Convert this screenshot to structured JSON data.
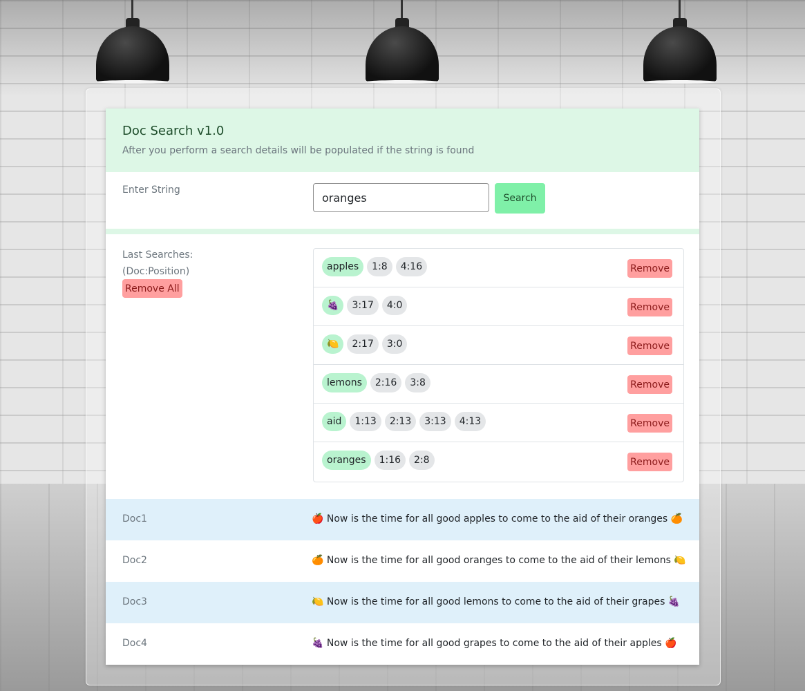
{
  "header": {
    "title": "Doc Search v1.0",
    "subtitle": "After you perform a search details will be populated if the string is found"
  },
  "search": {
    "label": "Enter String",
    "value": "oranges",
    "button_label": "Search"
  },
  "history": {
    "label_line1": "Last Searches:",
    "label_line2": "(Doc:Position)",
    "remove_all_label": "Remove All",
    "remove_label": "Remove",
    "items": [
      {
        "term": "apples",
        "positions": [
          "1:8",
          "4:16"
        ]
      },
      {
        "term": "🍇",
        "positions": [
          "3:17",
          "4:0"
        ]
      },
      {
        "term": "🍋",
        "positions": [
          "2:17",
          "3:0"
        ]
      },
      {
        "term": "lemons",
        "positions": [
          "2:16",
          "3:8"
        ]
      },
      {
        "term": "aid",
        "positions": [
          "1:13",
          "2:13",
          "3:13",
          "4:13"
        ]
      },
      {
        "term": "oranges",
        "positions": [
          "1:16",
          "2:8"
        ]
      }
    ]
  },
  "documents": [
    {
      "name": "Doc1",
      "text": "🍎 Now is the time for all good apples to come to the aid of their oranges 🍊"
    },
    {
      "name": "Doc2",
      "text": "🍊 Now is the time for all good oranges to come to the aid of their lemons 🍋"
    },
    {
      "name": "Doc3",
      "text": "🍋 Now is the time for all good lemons to come to the aid of their grapes 🍇"
    },
    {
      "name": "Doc4",
      "text": "🍇 Now is the time for all good grapes to come to the aid of their apples 🍎"
    }
  ]
}
